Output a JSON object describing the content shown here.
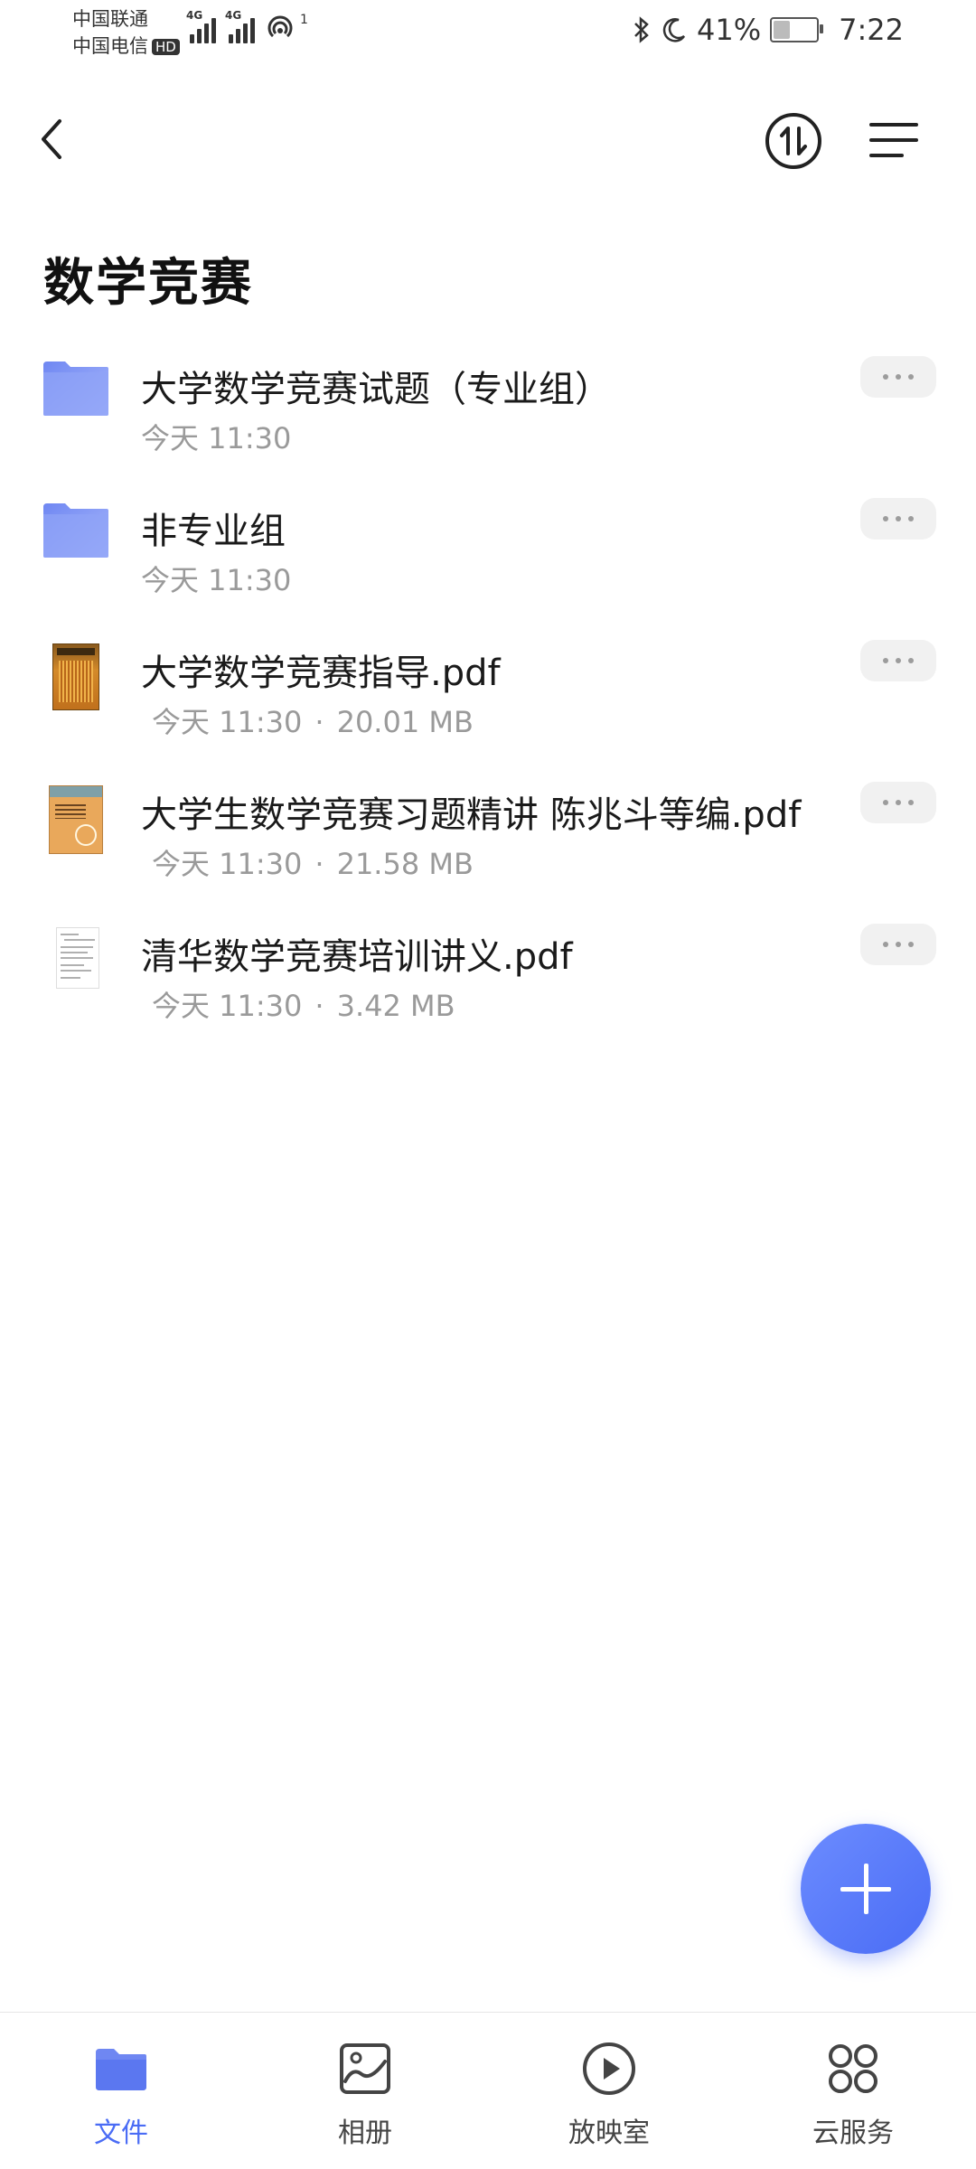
{
  "status_bar": {
    "carrier_1": "中国联通",
    "carrier_2": "中国电信",
    "hd_badge": "HD",
    "network_1": "4G",
    "network_2": "4G",
    "hotspot_count": "1",
    "battery": "41%",
    "time": "7:22",
    "battery_level": 0.41
  },
  "toolbar": {
    "back_icon": "chevron-left-icon",
    "sort_icon": "sort-arrows-icon",
    "menu_icon": "menu-lines-icon"
  },
  "page": {
    "title": "数学竞赛"
  },
  "files": [
    {
      "kind": "folder",
      "name": "大学数学竞赛试题（专业组）",
      "date": "今天 11:30",
      "size": ""
    },
    {
      "kind": "folder",
      "name": "非专业组",
      "date": "今天 11:30",
      "size": ""
    },
    {
      "kind": "pdf",
      "thumb": "book-orange",
      "name": "大学数学竞赛指导.pdf",
      "date": "今天 11:30",
      "size": "20.01 MB"
    },
    {
      "kind": "pdf",
      "thumb": "book-tan",
      "name": "大学生数学竞赛习题精讲 陈兆斗等编.pdf",
      "date": "今天 11:30",
      "size": "21.58 MB"
    },
    {
      "kind": "pdf",
      "thumb": "document",
      "name": "清华数学竞赛培训讲义.pdf",
      "date": "今天 11:30",
      "size": "3.42 MB"
    }
  ],
  "meta_separator": "·",
  "bottom_nav": [
    {
      "label": "文件",
      "icon": "folder-icon",
      "active": true
    },
    {
      "label": "相册",
      "icon": "photo-album-icon",
      "active": false
    },
    {
      "label": "放映室",
      "icon": "play-circle-icon",
      "active": false
    },
    {
      "label": "云服务",
      "icon": "grid-circles-icon",
      "active": false
    }
  ],
  "colors": {
    "accent": "#4a6cf5",
    "folder": "#7f95f5",
    "meta_text": "#9a9a9a"
  }
}
